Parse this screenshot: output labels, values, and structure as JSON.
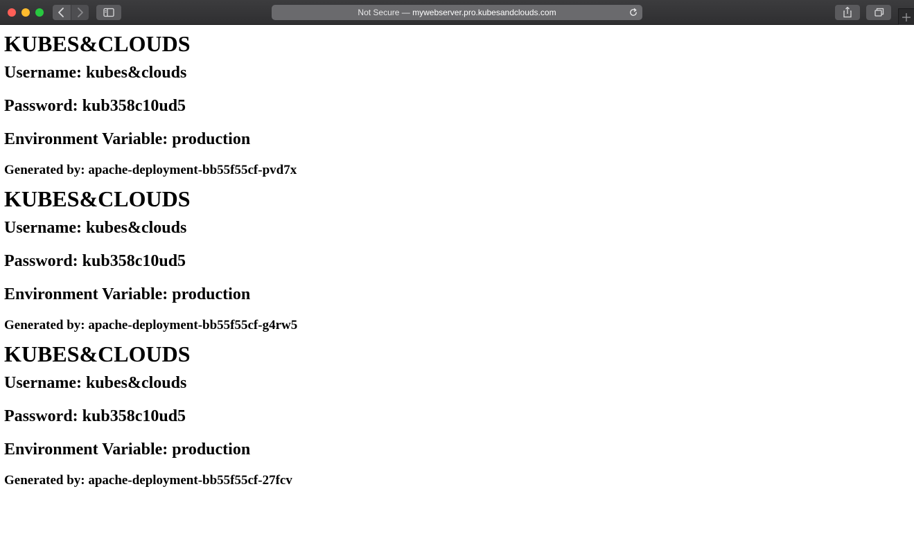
{
  "browser": {
    "address_prefix": "Not Secure — ",
    "address_host": "mywebserver.pro.kubesandclouds.com"
  },
  "page": {
    "blocks": [
      {
        "title": "KUBES&CLOUDS",
        "username": "Username: kubes&clouds",
        "password": "Password: kub358c10ud5",
        "environment": "Environment Variable: production",
        "generated_by": "Generated by: apache-deployment-bb55f55cf-pvd7x"
      },
      {
        "title": "KUBES&CLOUDS",
        "username": "Username: kubes&clouds",
        "password": "Password: kub358c10ud5",
        "environment": "Environment Variable: production",
        "generated_by": "Generated by: apache-deployment-bb55f55cf-g4rw5"
      },
      {
        "title": "KUBES&CLOUDS",
        "username": "Username: kubes&clouds",
        "password": "Password: kub358c10ud5",
        "environment": "Environment Variable: production",
        "generated_by": "Generated by: apache-deployment-bb55f55cf-27fcv"
      }
    ]
  },
  "icons": {
    "close": "close-window-icon",
    "minimize": "minimize-window-icon",
    "maximize": "maximize-window-icon",
    "back": "chevron-left-icon",
    "forward": "chevron-right-icon",
    "sidebar": "sidebar-icon",
    "reload": "reload-icon",
    "share": "share-icon",
    "tabs": "tab-overview-icon",
    "new_tab": "plus-icon"
  },
  "colors": {
    "close": "#fe5f57",
    "minimize": "#febc2e",
    "maximize": "#28c840",
    "toolbar": "#333335",
    "page_background": "#ffffff",
    "text": "#000000"
  }
}
